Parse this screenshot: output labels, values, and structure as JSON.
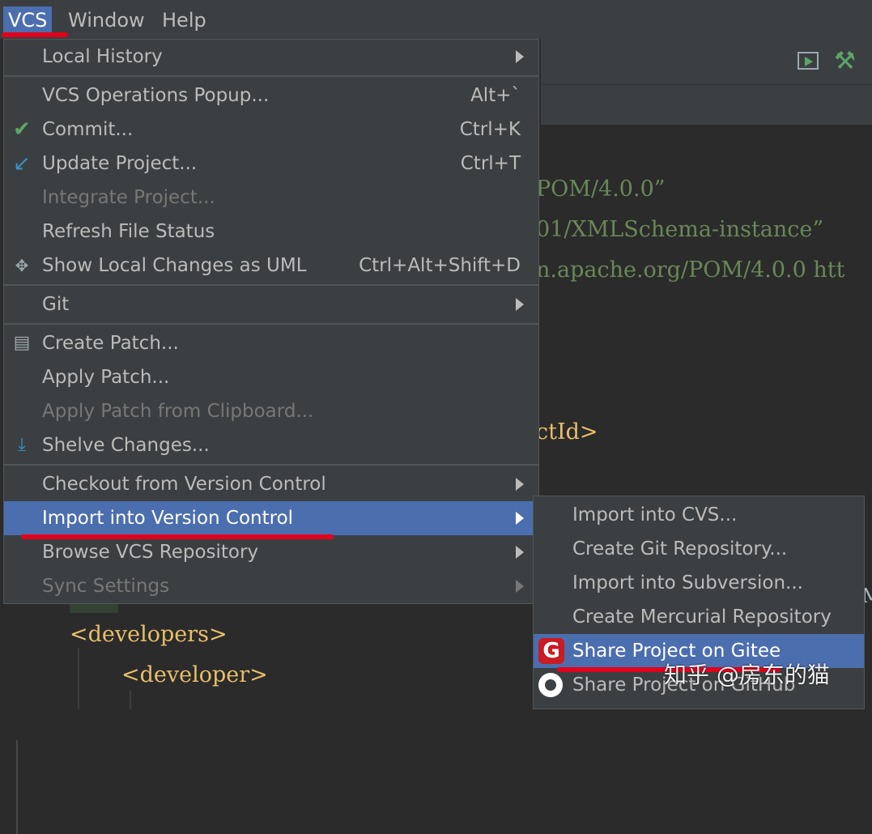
{
  "menubar": {
    "items": [
      "VCS",
      "Window",
      "Help"
    ]
  },
  "editor": {
    "lines": [
      "POM/4.0.0”",
      "01/XMLSchema-instance”",
      "n.apache.org/POM/4.0.0 htt",
      "ctId>",
      "<developers>",
      "<developer>",
      "M"
    ]
  },
  "vcs_menu": {
    "items": [
      {
        "label": "Local History",
        "shortcut": "",
        "submenu": true
      },
      {
        "label": "VCS Operations Popup...",
        "shortcut": "Alt+`"
      },
      {
        "label": "Commit...",
        "shortcut": "Ctrl+K",
        "icon": "check-icon"
      },
      {
        "label": "Update Project...",
        "shortcut": "Ctrl+T",
        "icon": "update-arrow-icon"
      },
      {
        "label": "Integrate Project...",
        "disabled": true
      },
      {
        "label": "Refresh File Status"
      },
      {
        "label": "Show Local Changes as UML",
        "shortcut": "Ctrl+Alt+Shift+D",
        "icon": "uml-icon"
      },
      {
        "label": "Git",
        "submenu": true
      },
      {
        "label": "Create Patch...",
        "icon": "patch-icon"
      },
      {
        "label": "Apply Patch..."
      },
      {
        "label": "Apply Patch from Clipboard...",
        "disabled": true
      },
      {
        "label": "Shelve Changes...",
        "icon": "shelve-icon"
      },
      {
        "label": "Checkout from Version Control",
        "submenu": true
      },
      {
        "label": "Import into Version Control",
        "submenu": true,
        "selected": true
      },
      {
        "label": "Browse VCS Repository",
        "submenu": true
      },
      {
        "label": "Sync Settings",
        "submenu": true,
        "disabled": true
      }
    ]
  },
  "import_submenu": {
    "items": [
      {
        "label": "Import into CVS..."
      },
      {
        "label": "Create Git Repository..."
      },
      {
        "label": "Import into Subversion..."
      },
      {
        "label": "Create Mercurial Repository"
      },
      {
        "label": "Share Project on Gitee",
        "icon": "gitee-icon",
        "selected": true
      },
      {
        "label": "Share Project on GitHub",
        "icon": "github-icon"
      }
    ]
  },
  "watermark": "知乎 @房东的猫",
  "colors": {
    "menu_bg": "#3c3f41",
    "selection": "#4b6eaf",
    "annotation_red": "#e3001b",
    "editor_bg": "#2b2b2b",
    "string_green": "#6a8759",
    "tag_yellow": "#e8bf6a"
  }
}
